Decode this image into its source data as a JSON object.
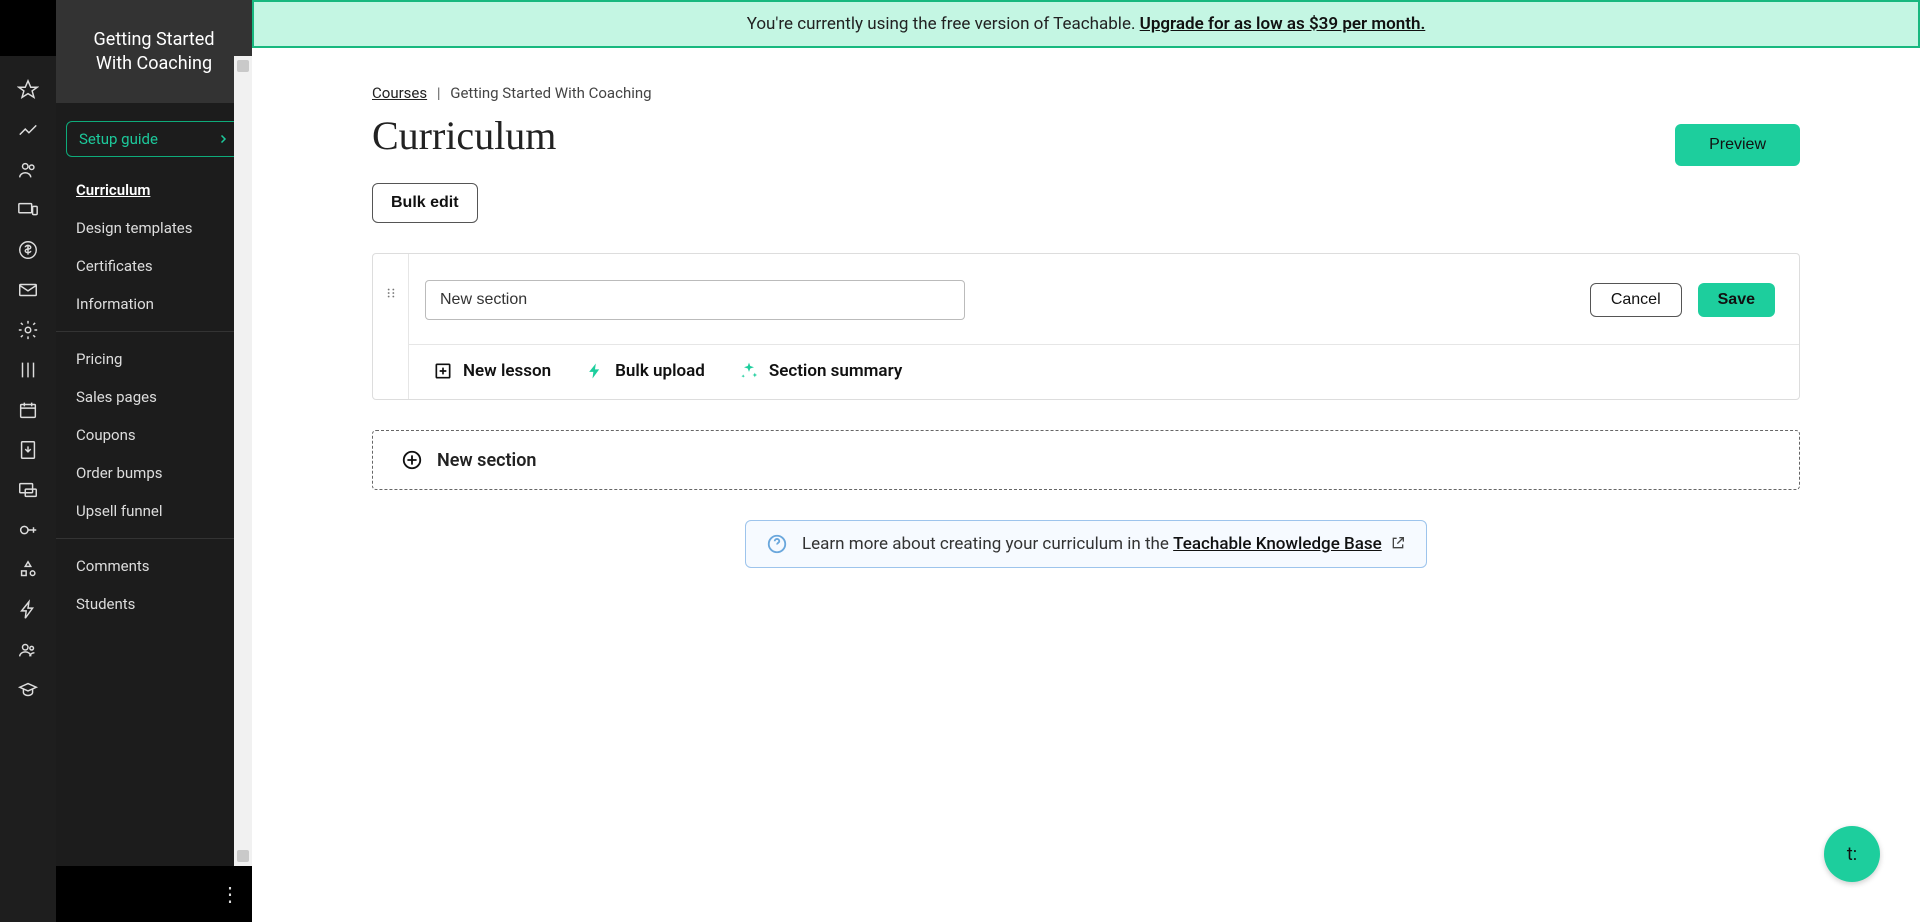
{
  "sidebar": {
    "title": "Getting Started With Coaching",
    "setup_guide": {
      "label": "Setup guide"
    },
    "items": [
      {
        "label": "Curriculum",
        "active": true
      },
      {
        "label": "Design templates"
      },
      {
        "label": "Certificates"
      },
      {
        "label": "Information"
      }
    ],
    "items2": [
      {
        "label": "Pricing"
      },
      {
        "label": "Sales pages"
      },
      {
        "label": "Coupons"
      },
      {
        "label": "Order bumps"
      },
      {
        "label": "Upsell funnel"
      }
    ],
    "items3": [
      {
        "label": "Comments"
      },
      {
        "label": "Students"
      }
    ]
  },
  "banner": {
    "text": "You're currently using the free version of Teachable. ",
    "link": "Upgrade for as low as $39 per month."
  },
  "crumbs": {
    "link": "Courses",
    "sep": "|",
    "current": "Getting Started With Coaching"
  },
  "page_title": "Curriculum",
  "buttons": {
    "preview": "Preview",
    "bulk_edit": "Bulk edit",
    "cancel": "Cancel",
    "save": "Save"
  },
  "section_editor": {
    "input_value": "New section"
  },
  "section_actions": {
    "new_lesson": "New lesson",
    "bulk_upload": "Bulk upload",
    "section_summary": "Section summary"
  },
  "new_section_bar": "New section",
  "help": {
    "text": "Learn more about creating your curriculum in the ",
    "link": "Teachable Knowledge Base"
  },
  "fab": "t:"
}
